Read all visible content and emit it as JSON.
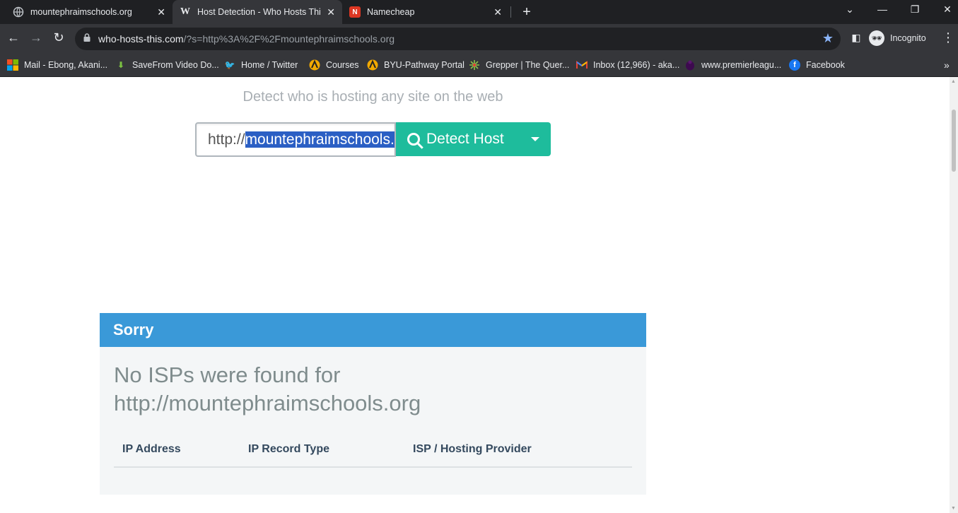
{
  "browser": {
    "tabs": [
      {
        "title": "mountephraimschools.org",
        "favicon": "globe-icon",
        "active": false
      },
      {
        "title": "Host Detection - Who Hosts This",
        "favicon": "W",
        "active": true
      },
      {
        "title": "Namecheap",
        "favicon": "namecheap-icon",
        "active": false
      }
    ],
    "url_host": "who-hosts-this.com",
    "url_path": "/?s=http%3A%2F%2Fmountephraimschools.org",
    "profile_label": "Incognito",
    "accent_color": "#8ab4f8"
  },
  "bookmarks": [
    {
      "label": "Mail - Ebong, Akani...",
      "icon": "microsoft-icon"
    },
    {
      "label": "SaveFrom Video Do...",
      "icon": "download-arrow-icon"
    },
    {
      "label": "Home / Twitter",
      "icon": "twitter-icon"
    },
    {
      "label": "Courses",
      "icon": "byu-icon"
    },
    {
      "label": "BYU-Pathway Portal",
      "icon": "byu-icon"
    },
    {
      "label": "Grepper | The Quer...",
      "icon": "grepper-icon"
    },
    {
      "label": "Inbox (12,966) - aka...",
      "icon": "gmail-icon"
    },
    {
      "label": "www.premierleagu...",
      "icon": "premier-league-icon"
    },
    {
      "label": "Facebook",
      "icon": "facebook-icon"
    }
  ],
  "hero": {
    "tagline": "Detect who is hosting any site on the web",
    "input_prefix": "http://",
    "input_selected": "mountephraimschools.org",
    "button_label": "Detect Host",
    "button_color": "#1ebc9c"
  },
  "result": {
    "header": "Sorry",
    "header_color": "#3a99d8",
    "message_line1": "No ISPs were found for",
    "message_line2": "http://mountephraimschools.org",
    "columns": [
      "IP Address",
      "IP Record Type",
      "ISP / Hosting Provider"
    ]
  }
}
